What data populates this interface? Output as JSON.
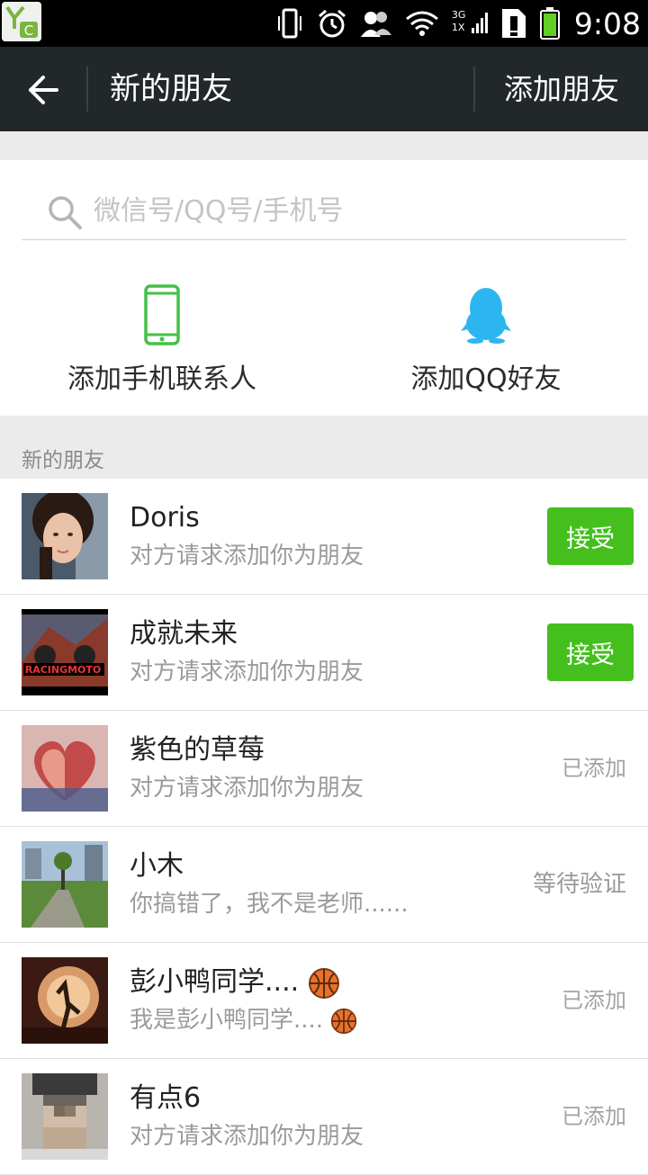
{
  "status_bar": {
    "time": "9:08",
    "network_label": "3G",
    "network_sub": "1X",
    "icons": [
      "vibrate-icon",
      "alarm-icon",
      "contacts-icon",
      "wifi-icon",
      "signal-icon",
      "sim-alert-icon",
      "battery-icon"
    ]
  },
  "header": {
    "title": "新的朋友",
    "action": "添加朋友"
  },
  "search": {
    "placeholder": "微信号/QQ号/手机号"
  },
  "add_options": [
    {
      "label": "添加手机联系人",
      "icon": "phone-icon",
      "color": "#44c046"
    },
    {
      "label": "添加QQ好友",
      "icon": "qq-penguin-icon",
      "color": "#2cb6ef"
    }
  ],
  "section_title": "新的朋友",
  "friends": [
    {
      "name": "Doris",
      "message": "对方请求添加你为朋友",
      "action": "接受"
    },
    {
      "name": "成就未来",
      "message": "对方请求添加你为朋友",
      "action": "接受"
    },
    {
      "name": "紫色的草莓",
      "message": "对方请求添加你为朋友",
      "status": "已添加"
    },
    {
      "name": "小木",
      "message": "你搞错了，我不是老师......",
      "status": "等待验证"
    },
    {
      "name": "彭小鸭同学....",
      "message": "我是彭小鸭同学....",
      "status": "已添加"
    },
    {
      "name": "有点6",
      "message": "对方请求添加你为朋友",
      "status": "已添加"
    }
  ],
  "colors": {
    "accent_green": "#44bf1e",
    "header_bg": "#22282a"
  }
}
